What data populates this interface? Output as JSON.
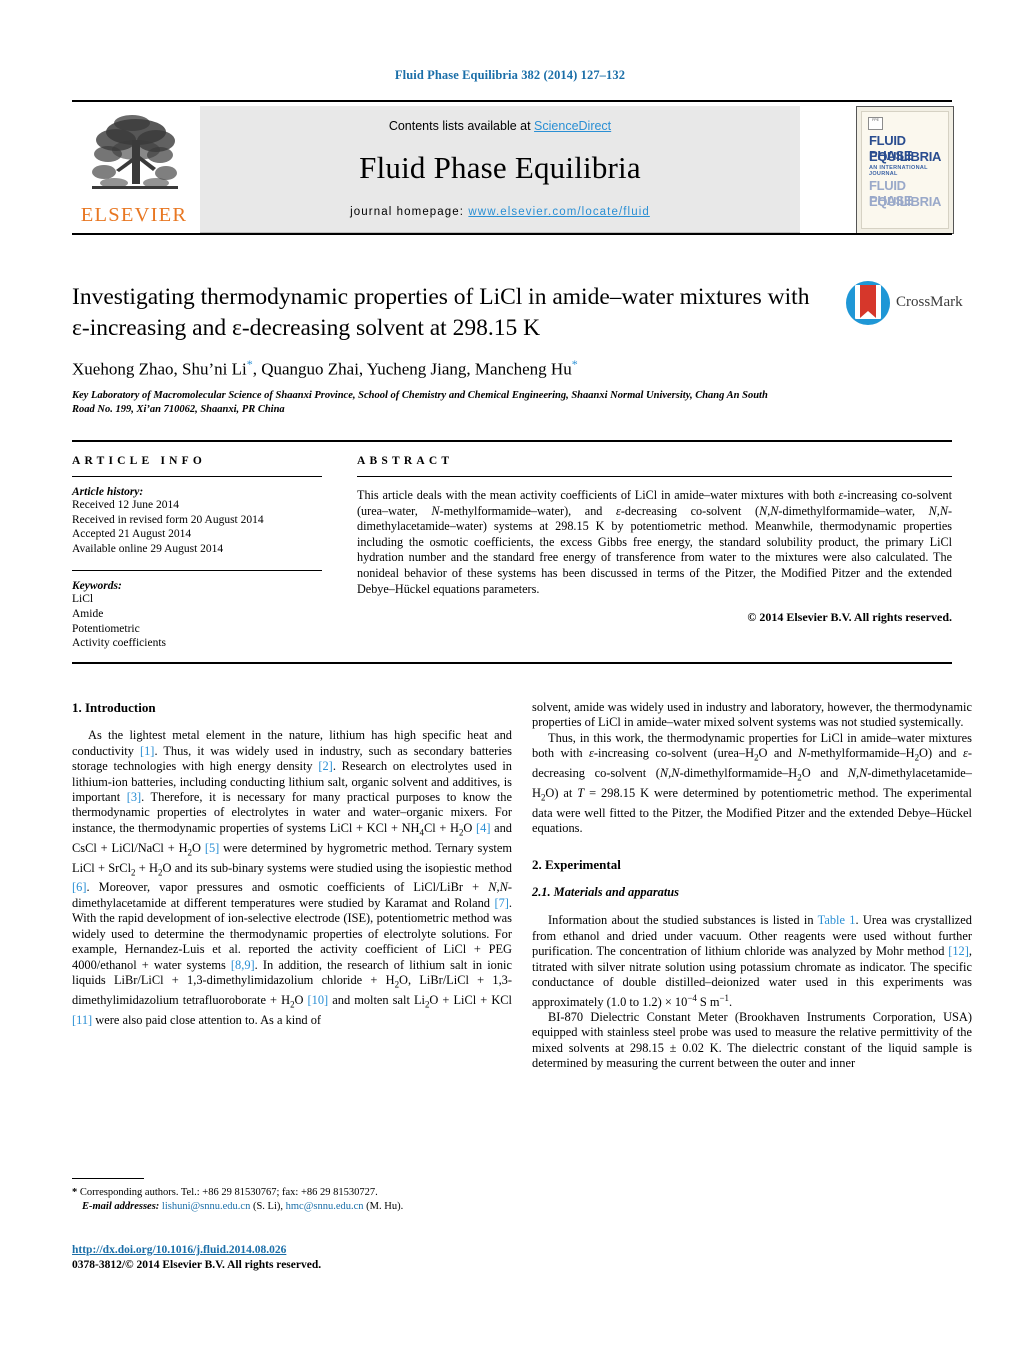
{
  "running_head": "Fluid Phase Equilibria 382 (2014) 127–132",
  "masthead": {
    "contents_prefix": "Contents lists available at ",
    "sciencedirect": "ScienceDirect",
    "journal_name": "Fluid Phase Equilibria",
    "homepage_label": "journal homepage:",
    "homepage_url": "www.elsevier.com/locate/fluid",
    "publisher_logo_text": "ELSEVIER",
    "cover": {
      "line1": "FLUID PHASE",
      "line2": "EQUILIBRIA",
      "line3": "AN INTERNATIONAL JOURNAL",
      "line4": "FLUID PHASE",
      "line5": "EQUILIBRIA",
      "mini_logo": "FPE"
    }
  },
  "article": {
    "title": "Investigating thermodynamic properties of LiCl in amide–water mixtures with ε-increasing and ε-decreasing solvent at 298.15 K",
    "authors_html": "Xuehong Zhao, Shu’ni Li<sup>*</sup>, Quanguo Zhai, Yucheng Jiang, Mancheng Hu<sup>*</sup>",
    "affiliation": "Key Laboratory of Macromolecular Science of Shaanxi Province, School of Chemistry and Chemical Engineering, Shaanxi Normal University, Chang An South Road No. 199, Xi’an 710062, Shaanxi, PR China",
    "crossmark_label": "CrossMark"
  },
  "article_info": {
    "heading": "ARTICLE INFO",
    "history_title": "Article history:",
    "history": [
      "Received 12 June 2014",
      "Received in revised form 20 August 2014",
      "Accepted 21 August 2014",
      "Available online 29 August 2014"
    ],
    "keywords_title": "Keywords:",
    "keywords": [
      "LiCl",
      "Amide",
      "Potentiometric",
      "Activity coefficients"
    ]
  },
  "abstract": {
    "heading": "ABSTRACT",
    "text_html": "This article deals with the mean activity coefficients of LiCl in amide–water mixtures with both <i>ε</i>-increasing co-solvent (urea–water, <i>N</i>-methylformamide–water), and <i>ε</i>-decreasing co-solvent (<i>N,N</i>-dimethylformamide–water, <i>N,N</i>-dimethylacetamide–water) systems at 298.15 K by potentiometric method. Meanwhile, thermodynamic properties including the osmotic coefficients, the excess Gibbs free energy, the standard solubility product, the primary LiCl hydration number and the standard free energy of transference from water to the mixtures were also calculated. The nonideal behavior of these systems has been discussed in terms of the Pitzer, the Modified Pitzer and the extended Debye–Hückel equations parameters.",
    "copyright": "© 2014 Elsevier B.V. All rights reserved."
  },
  "body": {
    "section1_heading": "1. Introduction",
    "intro_p1_html": "As the lightest metal element in the nature, lithium has high specific heat and conductivity <span class=\"ref\">[1]</span>. Thus, it was widely used in industry, such as secondary batteries storage technologies with high energy density <span class=\"ref\">[2]</span>. Research on electrolytes used in lithium-ion batteries, including conducting lithium salt, organic solvent and additives, is important <span class=\"ref\">[3]</span>. Therefore, it is necessary for many practical purposes to know the thermodynamic properties of electrolytes in water and water–organic mixers. For instance, the thermodynamic properties of systems LiCl + KCl + NH<sub>4</sub>Cl + H<sub>2</sub>O <span class=\"ref\">[4]</span> and CsCl + LiCl/NaCl + H<sub>2</sub>O <span class=\"ref\">[5]</span> were determined by hygrometric method. Ternary system LiCl + SrCl<sub>2</sub> + H<sub>2</sub>O and its sub-binary systems were studied using the isopiestic method <span class=\"ref\">[6]</span>. Moreover, vapor pressures and osmotic coefficients of LiCl/LiBr + <i>N,N</i>-dimethylacetamide at different temperatures were studied by Karamat and Roland <span class=\"ref\">[7]</span>. With the rapid development of ion-selective electrode (ISE), potentiometric method was widely used to determine the thermodynamic properties of electrolyte solutions. For example, Hernandez-Luis et al. reported the activity coefficient of LiCl + PEG 4000/ethanol + water systems <span class=\"ref\">[8,9]</span>. In addition, the research of lithium salt in ionic liquids LiBr/LiCl + 1,3-dimethylimidazolium chloride + H<sub>2</sub>O, LiBr/LiCl + 1,3-dimethylimidazolium tetrafluoroborate + H<sub>2</sub>O <span class=\"ref\">[10]</span> and molten salt Li<sub>2</sub>O + LiCl + KCl <span class=\"ref\">[11]</span> were also paid close attention to. As a kind of",
    "intro_p1_cont_html": "solvent, amide was widely used in industry and laboratory, however, the thermodynamic properties of LiCl in amide–water mixed solvent systems was not studied systemically.",
    "intro_p2_html": "Thus, in this work, the thermodynamic properties for LiCl in amide–water mixtures both with <i>ε</i>-increasing co-solvent (urea–H<sub>2</sub>O and <i>N</i>-methylformamide–H<sub>2</sub>O) and <i>ε</i>-decreasing co-solvent (<i>N,N</i>-dimethylformamide–H<sub>2</sub>O and <i>N,N</i>-dimethylacetamide–H<sub>2</sub>O) at <i>T</i> = 298.15 K were determined by potentiometric method. The experimental data were well fitted to the Pitzer, the Modified Pitzer and the extended Debye–Hückel equations.",
    "section2_heading": "2. Experimental",
    "subsection21_heading": "2.1. Materials and apparatus",
    "exp_p1_html": "Information about the studied substances is listed in <span class=\"ref\">Table 1</span>. Urea was crystallized from ethanol and dried under vacuum. Other reagents were used without further purification. The concentration of lithium chloride was analyzed by Mohr method <span class=\"ref\">[12]</span>, titrated with silver nitrate solution using potassium chromate as indicator. The specific conductance of double distilled–deionized water used in this experiments was approximately (1.0 to 1.2) × 10<sup>−4</sup> S m<sup>−1</sup>.",
    "exp_p2_html": "BI-870 Dielectric Constant Meter (Brookhaven Instruments Corporation, USA) equipped with stainless steel probe was used to measure the relative permittivity of the mixed solvents at 298.15 ± 0.02 K. The dielectric constant of the liquid sample is determined by measuring the current between the outer and inner"
  },
  "footer": {
    "corresponding_html": "<b>*</b> Corresponding authors. Tel.: +86 29 81530767; fax: +86 29 81530727.",
    "email_html": "<span class=\"ital\">E-mail addresses:</span> <span class=\"mail-link\">lishuni@snnu.edu.cn</span> (S. Li), <span class=\"mail-link\">hmc@snnu.edu.cn</span> (M. Hu).",
    "doi": "http://dx.doi.org/10.1016/j.fluid.2014.08.026",
    "issn_line": "0378-3812/© 2014 Elsevier B.V. All rights reserved."
  },
  "colors": {
    "link_blue": "#2a8fd4",
    "head_blue": "#1a6ea8",
    "elsevier_orange": "#e87722",
    "crossmark_blue": "#1f97d6",
    "crossmark_red": "#d6372b"
  }
}
